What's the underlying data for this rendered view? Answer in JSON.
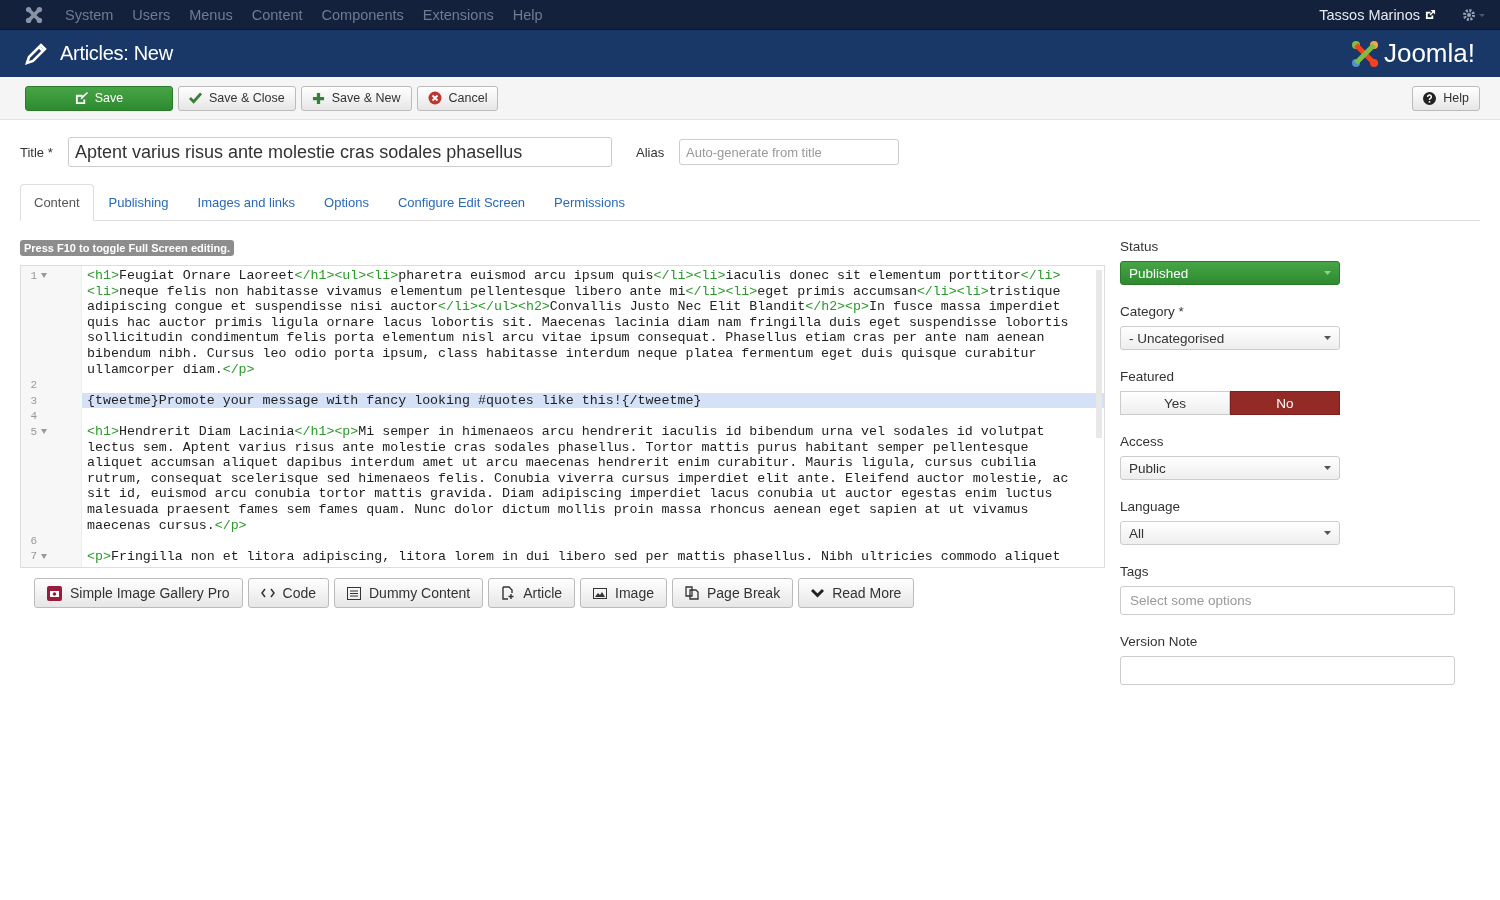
{
  "topnav": {
    "menu": [
      "System",
      "Users",
      "Menus",
      "Content",
      "Components",
      "Extensions",
      "Help"
    ],
    "user": "Tassos Marinos"
  },
  "header": {
    "title": "Articles: New",
    "logo_text": "Joomla!"
  },
  "toolbar": {
    "buttons": [
      {
        "kind": "save",
        "label": "Save"
      },
      {
        "kind": "check",
        "label": "Save & Close"
      },
      {
        "kind": "plus",
        "label": "Save & New"
      },
      {
        "kind": "cancel",
        "label": "Cancel"
      }
    ],
    "help": "Help"
  },
  "title_field": {
    "label": "Title",
    "required_mark": "*",
    "value": "Aptent varius risus ante molestie cras sodales phasellus"
  },
  "alias_field": {
    "label": "Alias",
    "placeholder": "Auto-generate from title"
  },
  "tabs": [
    {
      "label": "Content",
      "selected": true
    },
    {
      "label": "Publishing",
      "selected": false
    },
    {
      "label": "Images and links",
      "selected": false
    },
    {
      "label": "Options",
      "selected": false
    },
    {
      "label": "Configure Edit Screen",
      "selected": false
    },
    {
      "label": "Permissions",
      "selected": false
    }
  ],
  "editor": {
    "hint": "Press F10 to toggle Full Screen editing.",
    "lines": [
      {
        "number": "1",
        "foldable": true,
        "selected": false,
        "rows": [
          "<h1>Feugiat Ornare Laoreet</h1><ul><li>pharetra euismod arcu ipsum quis</li><li>iaculis donec sit elementum porttitor</li>",
          "<li>neque felis non habitasse vivamus elementum pellentesque libero ante mi</li><li>eget primis accumsan</li><li>tristique",
          "adipiscing congue et suspendisse nisi auctor</li></ul><h2>Convallis Justo Nec Elit Blandit</h2><p>In fusce massa imperdiet",
          "quis hac auctor primis ligula ornare lacus lobortis sit. Maecenas lacinia diam nam fringilla duis eget suspendisse lobortis",
          "sollicitudin condimentum felis porta elementum nisl arcu vitae ipsum consequat. Phasellus etiam cras per ante nam aenean",
          "bibendum nibh. Cursus leo odio porta ipsum, class habitasse interdum neque platea fermentum eget duis quisque curabitur",
          "ullamcorper diam.</p>"
        ]
      },
      {
        "number": "2",
        "foldable": false,
        "selected": false
      },
      {
        "number": "3",
        "foldable": false,
        "selected": true,
        "rows": [
          "{tweetme}Promote your message with fancy looking #quotes like this!{/tweetme}"
        ]
      },
      {
        "number": "4",
        "foldable": false,
        "selected": false
      },
      {
        "number": "5",
        "foldable": true,
        "selected": false,
        "rows": [
          "<h1>Hendrerit Diam Lacinia</h1><p>Mi semper in himenaeos arcu hendrerit iaculis id bibendum urna vel sodales id volutpat",
          "lectus sem. Aptent varius risus ante molestie cras sodales phasellus. Tortor mattis purus habitant semper pellentesque",
          "aliquet accumsan aliquet dapibus interdum amet ut arcu maecenas hendrerit enim curabitur. Mauris ligula, cursus cubilia",
          "rutrum, consequat scelerisque sed himenaeos felis. Conubia viverra cursus imperdiet elit ante. Eleifend auctor molestie, ac",
          "sit id, euismod arcu conubia tortor mattis gravida. Diam adipiscing imperdiet lacus conubia ut auctor egestas enim luctus",
          "malesuada praesent fames sem fames quam. Nunc dolor dictum mollis proin massa rhoncus aenean eget sapien at ut vivamus",
          "maecenas cursus.</p>"
        ]
      },
      {
        "number": "6",
        "foldable": false,
        "selected": false
      },
      {
        "number": "7",
        "foldable": true,
        "selected": false,
        "rows": [
          "<p>Fringilla non et litora adipiscing, litora lorem in dui libero sed per mattis phasellus. Nibh ultricies commodo aliquet"
        ]
      }
    ]
  },
  "editor_buttons": [
    {
      "kind": "gallery",
      "label": "Simple Image Gallery Pro"
    },
    {
      "kind": "code",
      "label": "Code"
    },
    {
      "kind": "list",
      "label": "Dummy Content"
    },
    {
      "kind": "article",
      "label": "Article"
    },
    {
      "kind": "image",
      "label": "Image"
    },
    {
      "kind": "pages",
      "label": "Page Break"
    },
    {
      "kind": "chevron",
      "label": "Read More"
    }
  ],
  "sidebar": {
    "status": {
      "label": "Status",
      "value": "Published"
    },
    "category": {
      "label": "Category",
      "required_mark": "*",
      "value": "- Uncategorised"
    },
    "featured": {
      "label": "Featured",
      "options": [
        {
          "label": "Yes",
          "selected": false
        },
        {
          "label": "No",
          "selected": true
        }
      ]
    },
    "access": {
      "label": "Access",
      "value": "Public"
    },
    "language": {
      "label": "Language",
      "value": "All"
    },
    "tags": {
      "label": "Tags",
      "placeholder": "Select some options"
    },
    "version_note": {
      "label": "Version Note"
    }
  }
}
